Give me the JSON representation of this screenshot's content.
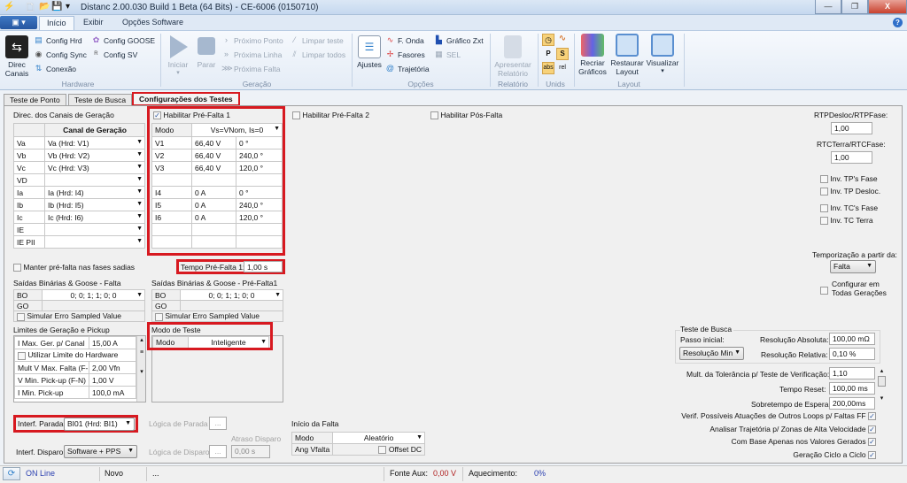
{
  "window": {
    "title": "Distanc 2.00.030 Build 1 Beta (64 Bits) - CE-6006 (0150710)",
    "minimize": "—",
    "restore": "❐",
    "close": "X",
    "help_icon": "?"
  },
  "ribbon_tabs": [
    "Início",
    "Exibir",
    "Opções Software"
  ],
  "ribbon": {
    "hardware": {
      "label": "Hardware",
      "direc_canais": "Direc\nCanais",
      "direc_line1": "Direc",
      "direc_line2": "Canais",
      "config_hrd": "Config Hrd",
      "config_sync": "Config Sync",
      "conexao": "Conexão",
      "config_goose": "Config GOOSE",
      "config_sv": "Config SV"
    },
    "geracao": {
      "label": "Geração",
      "iniciar": "Iniciar",
      "parar": "Parar",
      "proximo_ponto": "Próximo Ponto",
      "proxima_linha": "Próxima Linha",
      "proxima_falta": "Próxima Falta",
      "limpar_teste": "Limpar teste",
      "limpar_todos": "Limpar todos"
    },
    "opcoes": {
      "label": "Opções",
      "ajustes": "Ajustes",
      "f_onda": "F. Onda",
      "fasores": "Fasores",
      "trajetoria": "Trajetória",
      "grafico_zxt": "Gráfico Zxt",
      "sel": "SEL"
    },
    "relatorio": {
      "label": "Relatório",
      "apresentar_line1": "Apresentar",
      "apresentar_line2": "Relatório"
    },
    "unids": {
      "label": "Unids",
      "btn_abs": "abs",
      "btn_rel": "rel"
    },
    "layout": {
      "label": "Layout",
      "recriar_line1": "Recriar",
      "recriar_line2": "Gráficos",
      "restaurar_line1": "Restaurar",
      "restaurar_line2": "Layout",
      "visualizar": "Visualizar"
    }
  },
  "page_tabs": [
    "Teste de Ponto",
    "Teste de Busca",
    "Configurações dos Testes"
  ],
  "canais": {
    "title": "Direc. dos Canais de Geração",
    "header": "Canal de Geração",
    "rows": [
      {
        "name": "Va",
        "value": "Va (Hrd: V1)"
      },
      {
        "name": "Vb",
        "value": "Vb (Hrd: V2)"
      },
      {
        "name": "Vc",
        "value": "Vc (Hrd: V3)"
      },
      {
        "name": "VD",
        "value": ""
      },
      {
        "name": "Ia",
        "value": "Ia (Hrd: I4)"
      },
      {
        "name": "Ib",
        "value": "Ib (Hrd: I5)"
      },
      {
        "name": "Ic",
        "value": "Ic (Hrd: I6)"
      },
      {
        "name": "IE",
        "value": ""
      },
      {
        "name": "IE PII",
        "value": ""
      }
    ],
    "manter_prefalta": "Manter pré-falta nas fases sadias"
  },
  "prefalta1": {
    "enable_label": "Habilitar Pré-Falta 1",
    "enabled": true,
    "modo_label": "Modo",
    "modo_value": "Vs=VNom, Is=0",
    "rows": [
      {
        "ch": "V1",
        "mag": "66,40 V",
        "ang": "0 °"
      },
      {
        "ch": "V2",
        "mag": "66,40 V",
        "ang": "240,0 °"
      },
      {
        "ch": "V3",
        "mag": "66,40 V",
        "ang": "120,0 °"
      },
      {
        "ch": "",
        "mag": "",
        "ang": ""
      },
      {
        "ch": "I4",
        "mag": "0 A",
        "ang": "0 °"
      },
      {
        "ch": "I5",
        "mag": "0 A",
        "ang": "240,0 °"
      },
      {
        "ch": "I6",
        "mag": "0 A",
        "ang": "120,0 °"
      },
      {
        "ch": "",
        "mag": "",
        "ang": ""
      },
      {
        "ch": "",
        "mag": "",
        "ang": ""
      }
    ],
    "tempo_label": "Tempo Pré-Falta 1:",
    "tempo_value": "1,00 s"
  },
  "prefalta2": {
    "label": "Habilitar Pré-Falta 2",
    "enabled": false
  },
  "posfalta": {
    "label": "Habilitar Pós-Falta",
    "enabled": false
  },
  "saidas_falta": {
    "title": "Saídas Binárias & Goose - Falta",
    "bo_label": "BO",
    "bo_value": "0; 0; 1; 1; 0; 0",
    "go_label": "GO",
    "go_value": "",
    "simular": "Simular Erro Sampled Value"
  },
  "saidas_prefalta": {
    "title": "Saídas Binárias & Goose - Pré-Falta1",
    "bo_label": "BO",
    "bo_value": "0; 0; 1; 1; 0; 0",
    "go_label": "GO",
    "go_value": "",
    "simular": "Simular Erro Sampled Value"
  },
  "limites": {
    "title": "Limites de Geração e Pickup",
    "rows": [
      {
        "label": "I Max. Ger. p/ Canal",
        "value": "15,00 A"
      },
      {
        "label": "Utilizar Limite do Hardware",
        "value": ""
      },
      {
        "label": "Mult V Max. Falta (F-N)",
        "value": "2,00 Vfn"
      },
      {
        "label": "V Min. Pick-up (F-N)",
        "value": "1,00 V"
      },
      {
        "label": "I Min. Pick-up",
        "value": "100,0 mA"
      }
    ]
  },
  "modo_teste": {
    "title": "Modo de Teste",
    "modo_label": "Modo",
    "modo_value": "Inteligente"
  },
  "interf": {
    "parada_label": "Interf. Parada",
    "parada_value": "BI01 (Hrd: BI1)",
    "disparo_label": "Interf. Disparo",
    "disparo_value": "Software + PPS",
    "logica_parada": "Lógica de Parada",
    "logica_disparo": "Lógica de Disparo",
    "ellipsis": "...",
    "atraso_label": "Atraso Disparo",
    "atraso_value": "0,00 s"
  },
  "inicio_falta": {
    "title": "Início da Falta",
    "modo_label": "Modo",
    "modo_value": "Aleatório",
    "ang_label": "Ang Vfalta",
    "ang_value": "",
    "offset_dc": "Offset DC"
  },
  "right_panel": {
    "rtp_label": "RTPDesloc/RTPFase:",
    "rtp_value": "1,00",
    "rtc_label": "RTCTerra/RTCFase:",
    "rtc_value": "1,00",
    "inv_tps_fase": "Inv. TP's Fase",
    "inv_tp_desloc": "Inv. TP Desloc.",
    "inv_tcs_fase": "Inv. TC's Fase",
    "inv_tc_terra": "Inv. TC Terra",
    "temporizacao_label": "Temporização a partir da:",
    "temporizacao_value": "Falta",
    "configurar_line1": "Configurar em",
    "configurar_line2": "Todas Gerações"
  },
  "teste_busca": {
    "title": "Teste de Busca",
    "passo_label": "Passo inicial:",
    "passo_value": "Resolução Min",
    "res_abs_label": "Resolução Absoluta:",
    "res_abs_value": "100,00 mΩ",
    "res_rel_label": "Resolução Relativa:",
    "res_rel_value": "0,10 %",
    "mult_tol_label": "Mult. da Tolerância p/ Teste de Verificação:",
    "mult_tol_value": "1,10",
    "tempo_reset_label": "Tempo Reset:",
    "tempo_reset_value": "100,00 ms",
    "sobretempo_label": "Sobretempo de Espera:",
    "sobretempo_value": "200,00ms",
    "checks": [
      {
        "label": "Verif. Possíveis Atuações de Outros Loops  p/ Faltas FF",
        "checked": true
      },
      {
        "label": "Analisar Trajetória p/ Zonas de Alta Velocidade",
        "checked": true
      },
      {
        "label": "Com Base Apenas nos Valores Gerados",
        "checked": true
      },
      {
        "label": "Geração Ciclo a Ciclo",
        "checked": true
      }
    ]
  },
  "status": {
    "online": "ON Line",
    "state": "Novo",
    "message": "...",
    "fonte_aux_label": "Fonte Aux:",
    "fonte_aux_value": "0,00 V",
    "aquecimento_label": "Aquecimento:",
    "aquecimento_value": "0%"
  },
  "colors": {
    "highlight": "#d71920",
    "fonte_value": "#b02020",
    "link_blue": "#2a3fb0"
  }
}
